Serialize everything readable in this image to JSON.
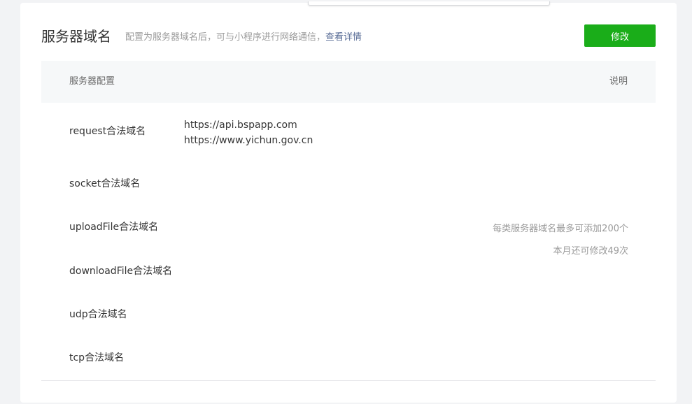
{
  "section": {
    "title": "服务器域名",
    "description": "配置为服务器域名后，可与小程序进行网络通信，",
    "description_link": "查看详情",
    "modify_label": "修改"
  },
  "table": {
    "col_config": "服务器配置",
    "col_note": "说明",
    "rows": [
      {
        "label": "request合法域名",
        "domains": [
          "https://api.bspapp.com",
          "https://www.yichun.gov.cn"
        ]
      },
      {
        "label": "socket合法域名",
        "domains": []
      },
      {
        "label": "uploadFile合法域名",
        "domains": []
      },
      {
        "label": "downloadFile合法域名",
        "domains": []
      },
      {
        "label": "udp合法域名",
        "domains": []
      },
      {
        "label": "tcp合法域名",
        "domains": []
      }
    ],
    "notes": [
      "每类服务器域名最多可添加200个",
      "本月还可修改49次"
    ]
  },
  "colors": {
    "accent_green": "#1aad19",
    "link_blue": "#576b95"
  }
}
